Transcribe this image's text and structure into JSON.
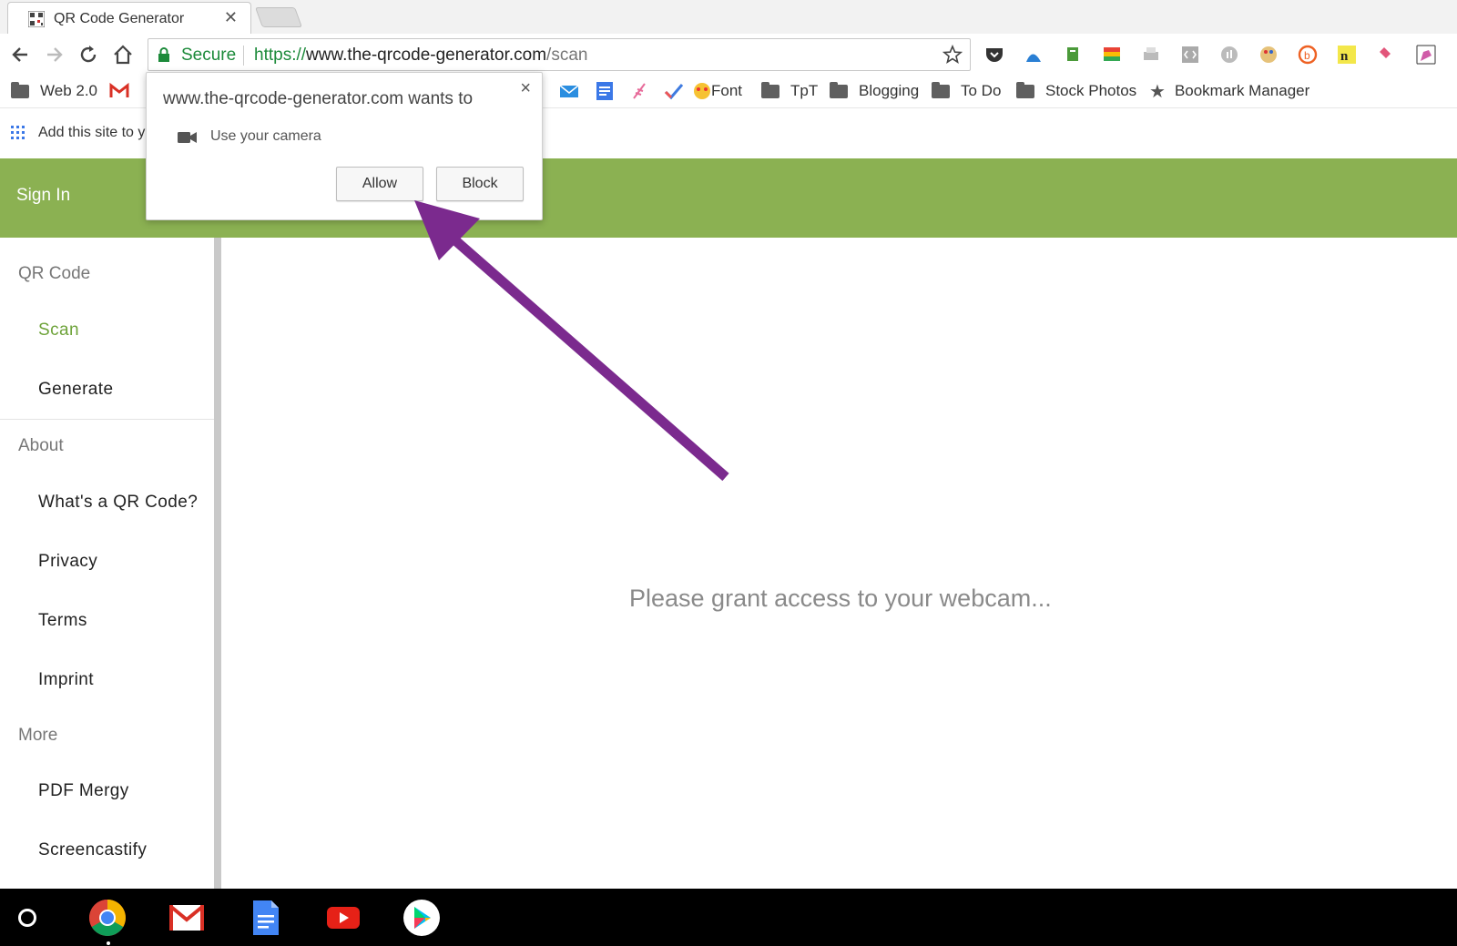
{
  "browser": {
    "tab": {
      "title": "QR Code Generator"
    },
    "toolbar": {
      "secure_label": "Secure",
      "url_scheme": "https://",
      "url_host": "www.the-qrcode-generator.com",
      "url_path": "/scan"
    },
    "bookmarks": {
      "web20": "Web 2.0",
      "font": "Font",
      "tpt": "TpT",
      "blogging": "Blogging",
      "todo": "To Do",
      "stock_photos": "Stock Photos",
      "bookmark_manager": "Bookmark Manager"
    },
    "apps_strip_text": "Add this site to y"
  },
  "permission_popup": {
    "title": "www.the-qrcode-generator.com wants to",
    "item": "Use your camera",
    "allow_label": "Allow",
    "block_label": "Block",
    "close_glyph": "×"
  },
  "site": {
    "header": {
      "signin_label": "Sign In"
    },
    "sidebar": {
      "sections": [
        {
          "label": "QR Code",
          "items": [
            "Scan",
            "Generate"
          ]
        },
        {
          "label": "About",
          "items": [
            "What's a QR Code?",
            "Privacy",
            "Terms",
            "Imprint"
          ]
        },
        {
          "label": "More",
          "items": [
            "PDF Mergy",
            "Screencastify"
          ]
        }
      ]
    },
    "main": {
      "message": "Please grant access to your webcam..."
    }
  },
  "colors": {
    "header_green": "#8bb152",
    "active_link": "#6ea33a",
    "annotation_arrow": "#7b2a8e",
    "secure_green": "#1c8a3a"
  }
}
